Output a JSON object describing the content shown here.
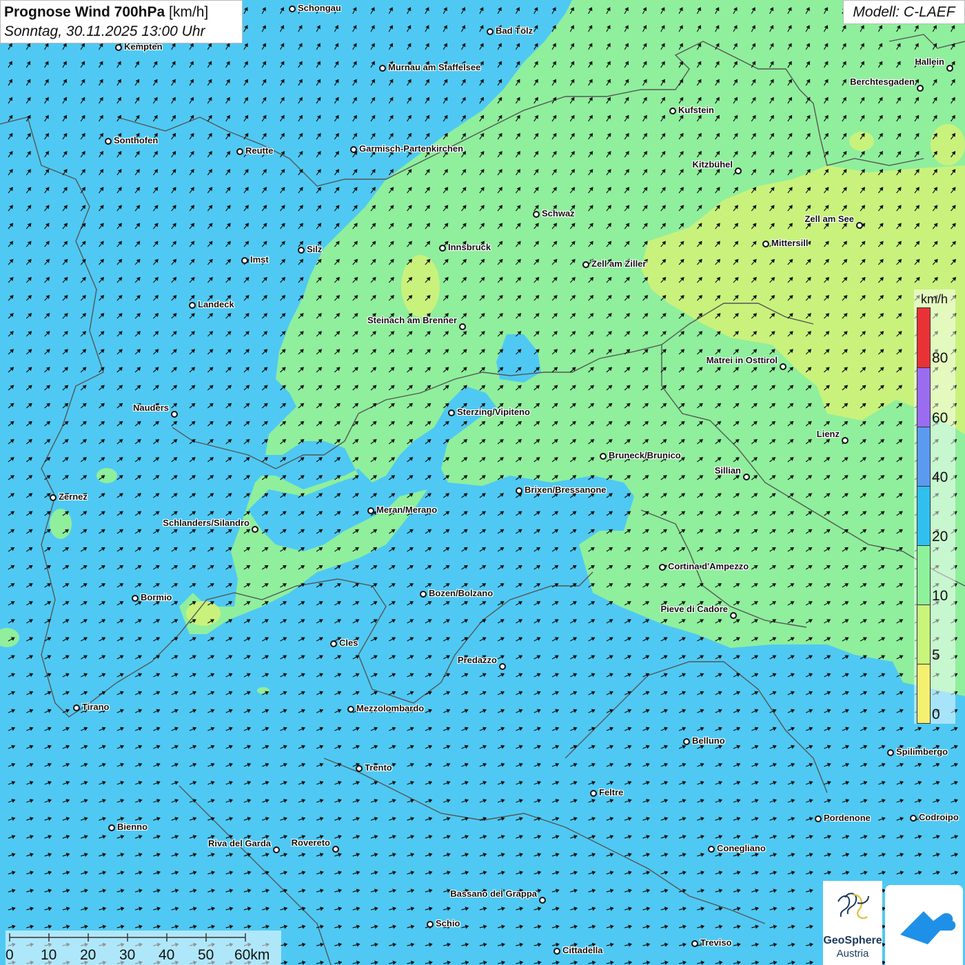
{
  "title": {
    "main": "Prognose Wind 700hPa",
    "unit": "[km/h]",
    "date": "Sonntag, 30.11.2025 13:00 Uhr"
  },
  "model": "Modell: C-LAEF",
  "legend": {
    "unit": "km/h",
    "ticks": [
      "80",
      "60",
      "40",
      "20",
      "10",
      "5",
      "0"
    ],
    "colors": [
      "#e83236",
      "#9a6cf0",
      "#5b9af0",
      "#2fc0f0",
      "#8ef29a",
      "#c8f57a",
      "#f5f070"
    ]
  },
  "scale_bar": {
    "labels": [
      "0",
      "10",
      "20",
      "30",
      "40",
      "50",
      "60km"
    ]
  },
  "logos": {
    "geosphere_name": "GeoSphere",
    "geosphere_sub": "Austria"
  },
  "colors": {
    "wind_0_5": "#f2f06e",
    "wind_5_10": "#c9f27c",
    "wind_10_20": "#8fef9c",
    "wind_20_40": "#4fc9f3",
    "border": "#555555"
  },
  "cities": [
    {
      "name": "Schongau"
    },
    {
      "name": "Bad Tölz"
    },
    {
      "name": "Kempten"
    },
    {
      "name": "Murnau am Staffelsee"
    },
    {
      "name": "Hallein"
    },
    {
      "name": "Berchtesgaden"
    },
    {
      "name": "Kufstein"
    },
    {
      "name": "Sonthofen"
    },
    {
      "name": "Reutte"
    },
    {
      "name": "Garmisch-Partenkirchen"
    },
    {
      "name": "Kitzbühel"
    },
    {
      "name": "Schwaz"
    },
    {
      "name": "Zell am See"
    },
    {
      "name": "Innsbruck"
    },
    {
      "name": "Mittersill"
    },
    {
      "name": "Silz"
    },
    {
      "name": "Imst"
    },
    {
      "name": "Zell am Ziller"
    },
    {
      "name": "Landeck"
    },
    {
      "name": "Steinach am Brenner"
    },
    {
      "name": "Matrei in Osttirol"
    },
    {
      "name": "Nauders"
    },
    {
      "name": "Sterzing/Vipiteno"
    },
    {
      "name": "Lienz"
    },
    {
      "name": "Bruneck/Brunico"
    },
    {
      "name": "Sillian"
    },
    {
      "name": "Brixen/Bressanone"
    },
    {
      "name": "Zernez"
    },
    {
      "name": "Meran/Merano"
    },
    {
      "name": "Schlanders/Silandro"
    },
    {
      "name": "Cortina d'Ampezzo"
    },
    {
      "name": "Bozen/Bolzano"
    },
    {
      "name": "Bormio"
    },
    {
      "name": "Pieve di Cadore"
    },
    {
      "name": "Cles"
    },
    {
      "name": "Predazzo"
    },
    {
      "name": "Tirano"
    },
    {
      "name": "Mezzolombardo"
    },
    {
      "name": "Belluno"
    },
    {
      "name": "Spilimbergo"
    },
    {
      "name": "Trento"
    },
    {
      "name": "Feltre"
    },
    {
      "name": "Pordenone"
    },
    {
      "name": "Codroipo"
    },
    {
      "name": "Bienno"
    },
    {
      "name": "Riva del Garda"
    },
    {
      "name": "Rovereto"
    },
    {
      "name": "Conegliano"
    },
    {
      "name": "Bassano del Grappa"
    },
    {
      "name": "Schio"
    },
    {
      "name": "Treviso"
    },
    {
      "name": "Cittadella"
    }
  ]
}
